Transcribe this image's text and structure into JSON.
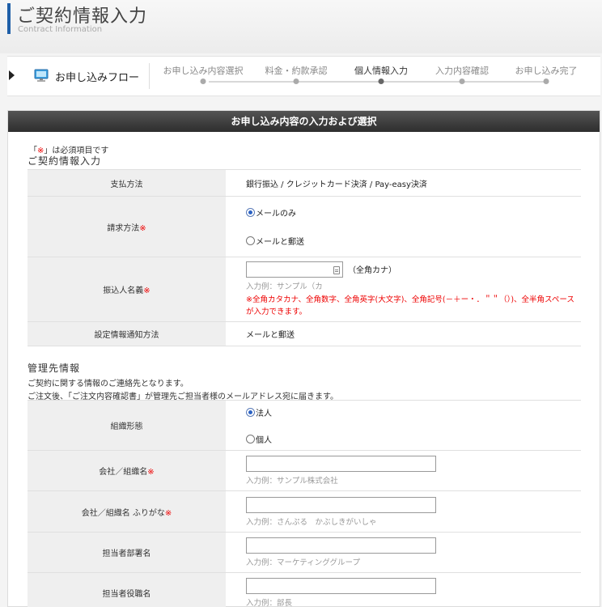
{
  "header": {
    "title": "ご契約情報入力",
    "subtitle": "Contract Information"
  },
  "flow": {
    "label": "お申し込みフロー",
    "steps": [
      {
        "label": "お申し込み内容選択",
        "active": false
      },
      {
        "label": "料金・約款承認",
        "active": false
      },
      {
        "label": "個人情報入力",
        "active": true
      },
      {
        "label": "入力内容確認",
        "active": false
      },
      {
        "label": "お申し込み完了",
        "active": false
      }
    ]
  },
  "panel": {
    "title": "お申し込み内容の入力および選択",
    "required_note_prefix": "「",
    "required_note_mark": "※",
    "required_note_suffix": "」は必須項目です",
    "contract_section": {
      "title": "ご契約情報入力",
      "payment_method": {
        "label": "支払方法",
        "value": "銀行振込 / クレジットカード決済 / Pay-easy決済"
      },
      "billing_method": {
        "label": "請求方法",
        "required_mark": "※",
        "options": [
          {
            "label": "メールのみ",
            "checked": true
          },
          {
            "label": "メールと郵送",
            "checked": false
          }
        ]
      },
      "payer_name": {
        "label": "振込人名義",
        "required_mark": "※",
        "value": "",
        "note": "（全角カナ）",
        "example": "入力例：サンプル（カ",
        "warning": "※全角カタカナ、全角数字、全角英字(大文字)、全角記号(－＋ー・．＂＂（）)、全半角スペースが入力できます。"
      },
      "notify_method": {
        "label": "設定情報通知方法",
        "value": "メールと郵送"
      }
    },
    "admin_section": {
      "title": "管理先情報",
      "desc1": "ご契約に関する情報のご連絡先となります。",
      "desc2": "ご注文後、「ご注文内容確認書」が管理先ご担当者様のメールアドレス宛に届きます。",
      "org_type": {
        "label": "組織形態",
        "options": [
          {
            "label": "法人",
            "checked": true
          },
          {
            "label": "個人",
            "checked": false
          }
        ]
      },
      "company": {
        "label": "会社／組織名",
        "required_mark": "※",
        "value": "",
        "example": "入力例：サンプル株式会社"
      },
      "company_kana": {
        "label": "会社／組織名 ふりがな",
        "required_mark": "※",
        "value": "",
        "example": "入力例：さんぷる　かぶしきがいしゃ"
      },
      "department": {
        "label": "担当者部署名",
        "value": "",
        "example": "入力例：マーケティンググループ"
      },
      "position": {
        "label": "担当者役職名",
        "value": "",
        "example": "入力例：部長"
      }
    }
  }
}
